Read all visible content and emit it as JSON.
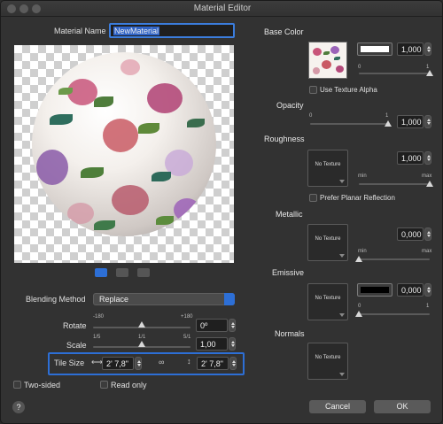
{
  "window": {
    "title": "Material Editor"
  },
  "material_name": {
    "label": "Material Name",
    "value": "NewMaterial"
  },
  "blending": {
    "label": "Blending Method",
    "value": "Replace"
  },
  "rotate": {
    "label": "Rotate",
    "min": "-180",
    "max": "+180",
    "value": "0º",
    "level": 0.5
  },
  "scale": {
    "label": "Scale",
    "left": "1/5",
    "mid": "1/1",
    "right": "5/1",
    "value": "1,00",
    "level": 0.5
  },
  "tile_size": {
    "label": "Tile Size",
    "width": "2' 7,8\"",
    "height": "2' 7,8\""
  },
  "options": {
    "two_sided": "Two-sided",
    "read_only": "Read only"
  },
  "base_color": {
    "title": "Base Color",
    "value": "1,000",
    "min": "0",
    "max": "1",
    "use_alpha": "Use Texture Alpha",
    "swatch": "#ffffff",
    "level": 1.0
  },
  "opacity": {
    "title": "Opacity",
    "min": "0",
    "max": "1",
    "value": "1,000",
    "level": 1.0
  },
  "roughness": {
    "title": "Roughness",
    "texture": "No Texture",
    "value": "1,000",
    "min": "min",
    "max": "max",
    "planar": "Prefer Planar Reflection",
    "level": 1.0
  },
  "metallic": {
    "title": "Metallic",
    "texture": "No Texture",
    "value": "0,000",
    "min": "min",
    "max": "max",
    "level": 0.0
  },
  "emissive": {
    "title": "Emissive",
    "texture": "No Texture",
    "value": "0,000",
    "min": "0",
    "max": "1",
    "swatch": "#000000",
    "level": 0.0
  },
  "normals": {
    "title": "Normals",
    "texture": "No Texture"
  },
  "buttons": {
    "cancel": "Cancel",
    "ok": "OK",
    "help": "?"
  },
  "colors": {
    "accent": "#2d6fd6",
    "window_bg": "#323232",
    "field_bg": "#1f1f1f"
  }
}
